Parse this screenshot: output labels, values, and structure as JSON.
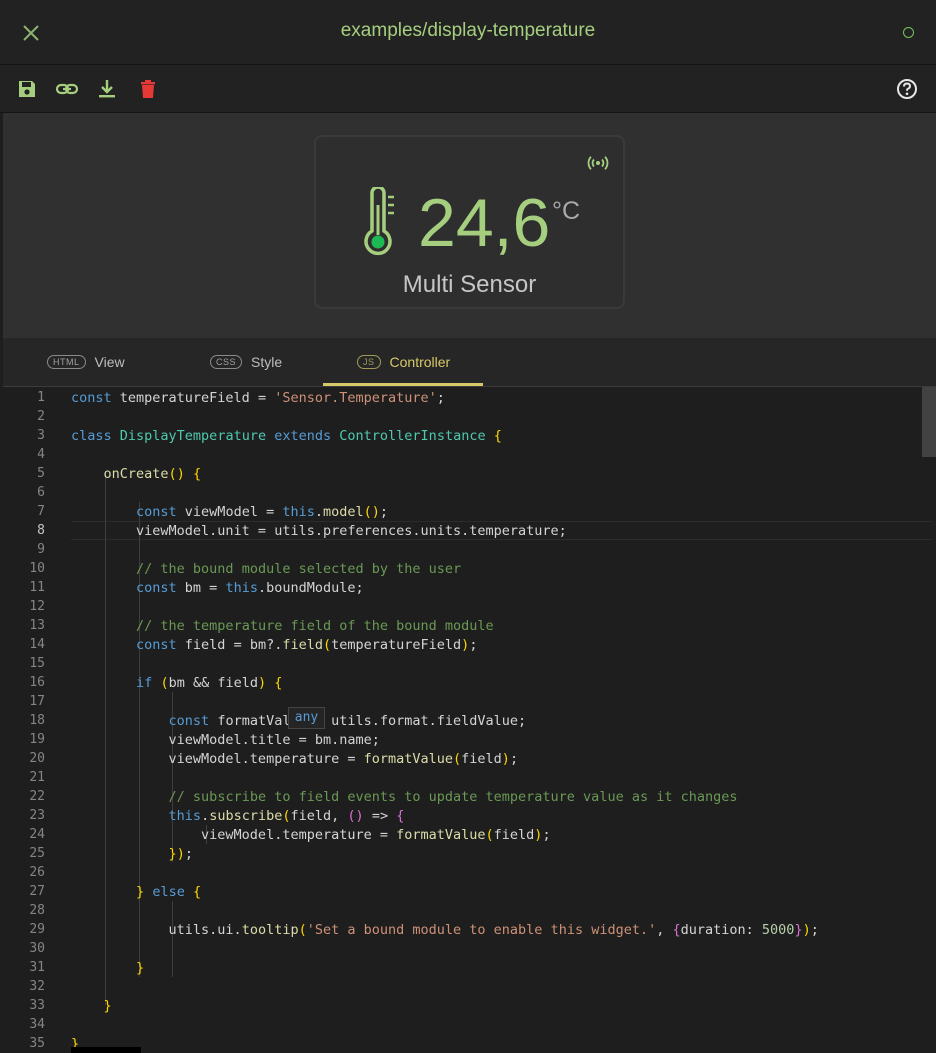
{
  "header": {
    "title": "examples/display-temperature",
    "close_icon": "close-icon",
    "status_icon": "status-dot-icon"
  },
  "toolbar": {
    "icons": [
      "save-icon",
      "link-icon",
      "download-icon",
      "delete-icon"
    ],
    "help_icon": "help-icon"
  },
  "widget": {
    "value": "24,6",
    "unit": "°C",
    "name": "Multi Sensor",
    "icon": "thermometer-icon",
    "signal_icon": "signal-icon"
  },
  "tabs": [
    {
      "badge": "HTML",
      "label": "View"
    },
    {
      "badge": "CSS",
      "label": "Style"
    },
    {
      "badge": "JS",
      "label": "Controller"
    }
  ],
  "editor": {
    "hover_tooltip": "any",
    "line_numbers": [
      "1",
      "2",
      "3",
      "4",
      "5",
      "6",
      "7",
      "8",
      "9",
      "10",
      "11",
      "12",
      "13",
      "14",
      "15",
      "16",
      "17",
      "18",
      "19",
      "20",
      "21",
      "22",
      "23",
      "24",
      "25",
      "26",
      "27",
      "28",
      "29",
      "30",
      "31",
      "32",
      "33",
      "34",
      "35"
    ],
    "current_line": 8,
    "lines": [
      "const temperatureField = 'Sensor.Temperature';",
      "",
      "class DisplayTemperature extends ControllerInstance {",
      "",
      "    onCreate() {",
      "",
      "        const viewModel = this.model();",
      "        viewModel.unit = utils.preferences.units.temperature;",
      "",
      "        // the bound module selected by the user",
      "        const bm = this.boundModule;",
      "",
      "        // the temperature field of the bound module",
      "        const field = bm?.field(temperatureField);",
      "",
      "        if (bm && field) {",
      "",
      "            const formatValue = utils.format.fieldValue;",
      "            viewModel.title = bm.name;",
      "            viewModel.temperature = formatValue(field);",
      "",
      "            // subscribe to field events to update temperature value as it changes",
      "            this.subscribe(field, () => {",
      "                viewModel.temperature = formatValue(field);",
      "            });",
      "",
      "        } else {",
      "",
      "            utils.ui.tooltip('Set a bound module to enable this widget.', {duration: 5000});",
      "",
      "        }",
      "",
      "    }",
      "",
      "}"
    ]
  }
}
